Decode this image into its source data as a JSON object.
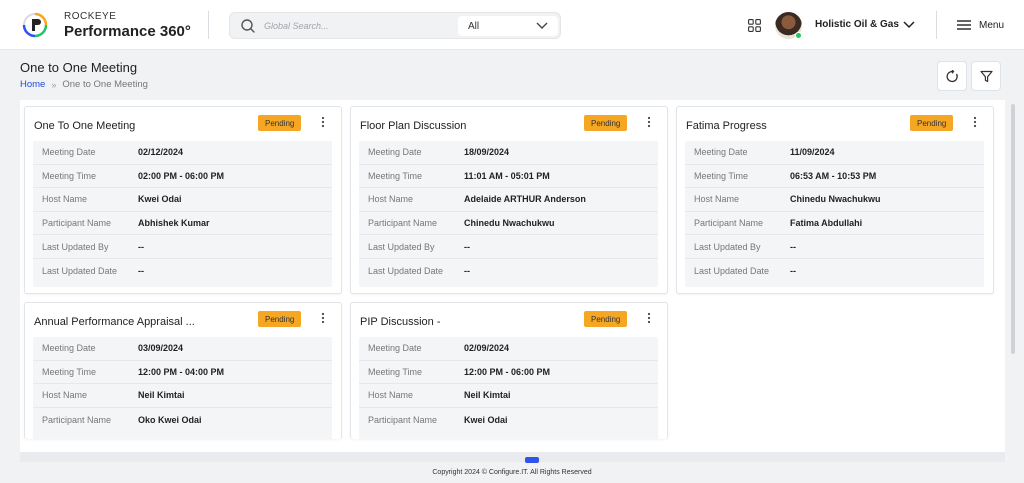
{
  "brand": {
    "small": "ROCKEYE",
    "big": "Performance 360°"
  },
  "search": {
    "placeholder": "Global Search...",
    "scope": "All"
  },
  "header": {
    "org_name": "Holistic Oil & Gas",
    "menu_label": "Menu"
  },
  "page": {
    "title": "One to One Meeting",
    "breadcrumb": [
      "Home",
      "One to One Meeting"
    ]
  },
  "field_labels": [
    "Meeting Date",
    "Meeting Time",
    "Host Name",
    "Participant Name",
    "Last Updated By",
    "Last Updated Date"
  ],
  "meetings": [
    {
      "title": "One To One Meeting",
      "status": "Pending",
      "values": [
        "02/12/2024",
        "02:00 PM - 06:00 PM",
        "Kwei Odai",
        "Abhishek Kumar",
        "--",
        "--"
      ]
    },
    {
      "title": "Floor Plan Discussion",
      "status": "Pending",
      "values": [
        "18/09/2024",
        "11:01 AM - 05:01 PM",
        "Adelaide ARTHUR Anderson",
        "Chinedu Nwachukwu",
        "--",
        "--"
      ]
    },
    {
      "title": "Fatima Progress",
      "status": "Pending",
      "values": [
        "11/09/2024",
        "06:53 AM - 10:53 PM",
        "Chinedu Nwachukwu",
        "Fatima Abdullahi",
        "--",
        "--"
      ]
    },
    {
      "title": "Annual Performance Appraisal ...",
      "status": "Pending",
      "values": [
        "03/09/2024",
        "12:00 PM - 04:00 PM",
        "Neil Kimtai",
        "Oko Kwei Odai",
        "",
        ""
      ]
    },
    {
      "title": "PIP Discussion -",
      "status": "Pending",
      "values": [
        "02/09/2024",
        "12:00 PM - 06:00 PM",
        "Neil Kimtai",
        "Kwei Odai",
        "",
        ""
      ]
    }
  ],
  "footer": "Copyright 2024 © Configure.IT. All Rights Reserved",
  "colors": {
    "badge": "#f5a623",
    "accent": "#2f54eb",
    "link": "#1d4ed8"
  }
}
